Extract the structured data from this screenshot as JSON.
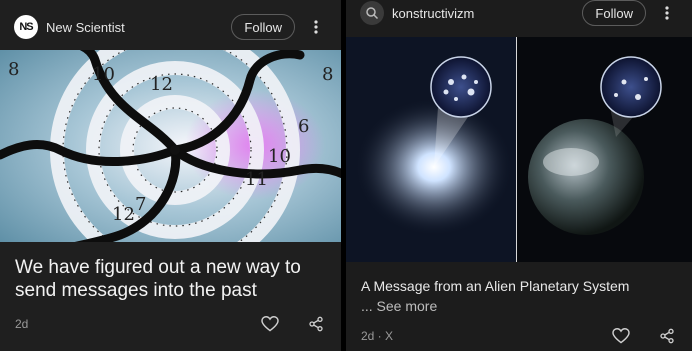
{
  "cards": [
    {
      "source": "New Scientist",
      "avatar_text": "NS",
      "follow_label": "Follow",
      "headline": "We have figured out a new way to send messages into the past",
      "time": "2d",
      "image": "spiral-clock-image",
      "icons": {
        "more": "more-vert-icon",
        "like": "heart-icon",
        "share": "share-icon"
      }
    },
    {
      "source": "konstructivizm",
      "follow_label": "Follow",
      "headline": "A Message from an Alien Planetary System",
      "see_more": "... See more",
      "time": "2d · X",
      "image": "alien-planetary-system-image",
      "icons": {
        "more": "more-vert-icon",
        "like": "heart-icon",
        "share": "share-icon"
      }
    }
  ],
  "colors": {
    "background": "#000000",
    "card": "#1f1f1f",
    "text": "#e8e8e8",
    "muted": "#9a9a9a",
    "border": "#5c5c5c"
  }
}
